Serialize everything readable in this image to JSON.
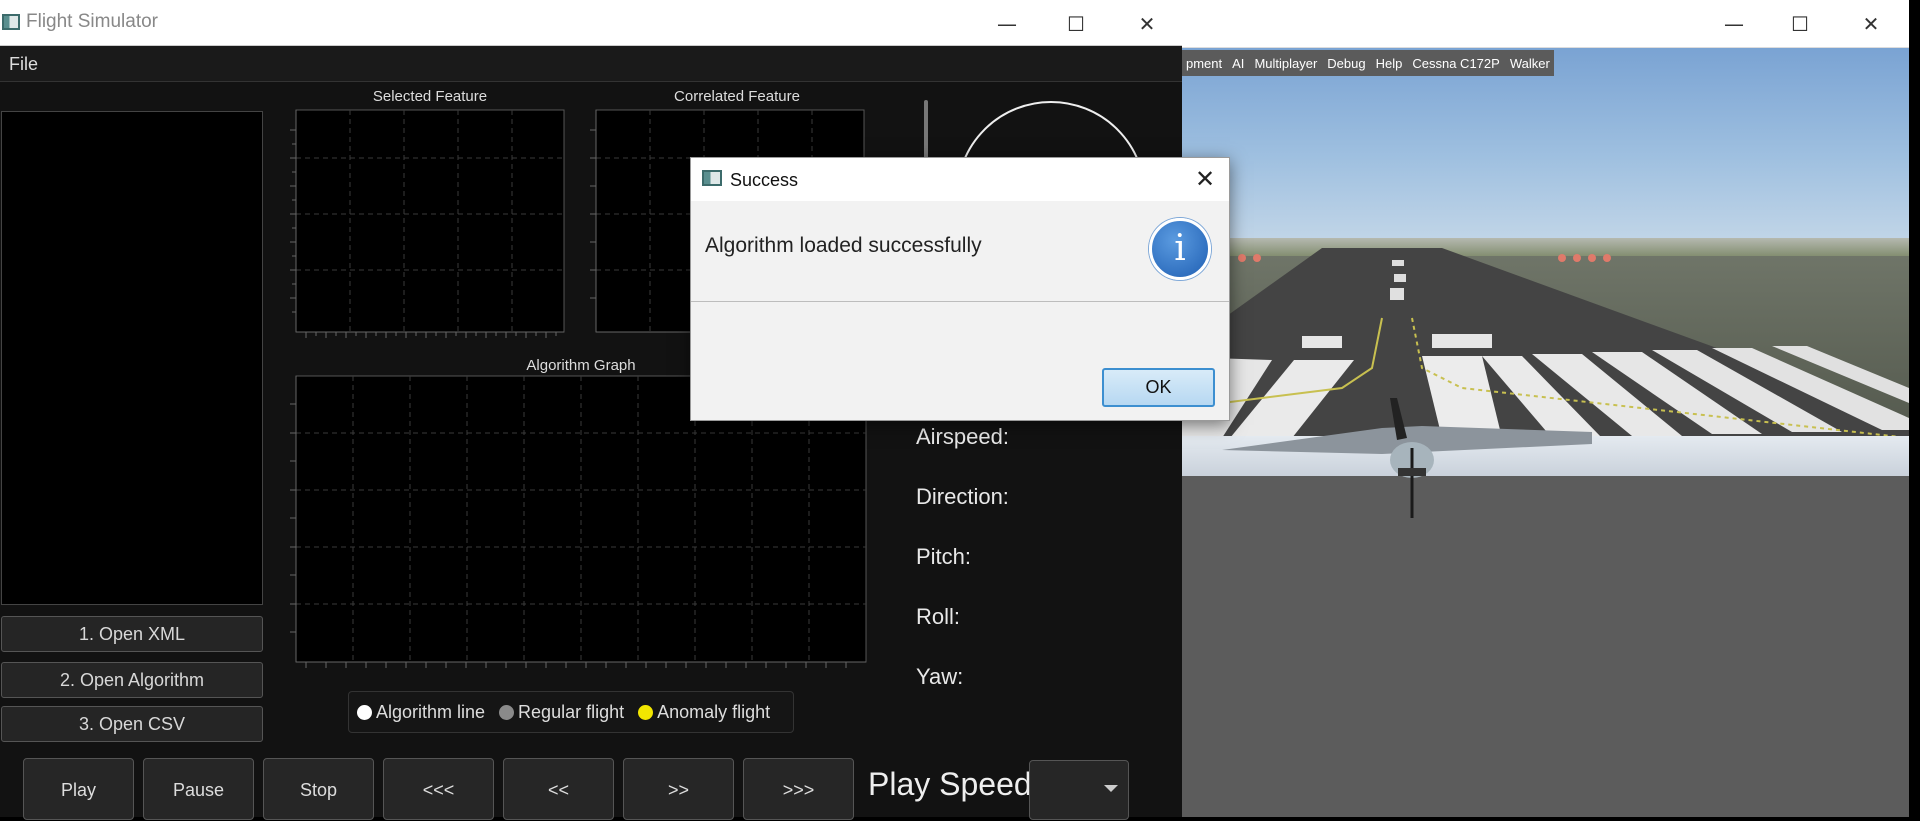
{
  "flightgear": {
    "menu": [
      "pment",
      "AI",
      "Multiplayer",
      "Debug",
      "Help",
      "Cessna C172P",
      "Walker"
    ],
    "controls": {
      "minimize": "—",
      "maximize": "☐",
      "close": "✕"
    }
  },
  "app": {
    "title": "Flight Simulator",
    "menu": {
      "file": "File"
    },
    "controls": {
      "minimize": "—",
      "maximize": "☐",
      "close": "✕"
    },
    "charts": {
      "selected_feature": "Selected Feature",
      "correlated_feature": "Correlated Feature",
      "algorithm_graph": "Algorithm Graph"
    },
    "buttons": {
      "open_xml": "1. Open XML",
      "open_algorithm": "2. Open Algorithm",
      "open_csv": "3. Open CSV"
    },
    "legend": [
      {
        "label": "Algorithm line",
        "color": "#ffffff"
      },
      {
        "label": "Regular flight",
        "color": "#8a8a8a"
      },
      {
        "label": "Anomaly flight",
        "color": "#f2e600"
      }
    ],
    "flight_data": {
      "airspeed": "Airspeed:",
      "direction": "Direction:",
      "pitch": "Pitch:",
      "roll": "Roll:",
      "yaw": "Yaw:"
    },
    "player": {
      "play": "Play",
      "pause": "Pause",
      "stop": "Stop",
      "rewind_fast": "<<<",
      "rewind": "<<",
      "forward": ">>",
      "forward_fast": ">>>",
      "play_speed_label": "Play Speed",
      "play_speed_value": ""
    }
  },
  "dialog": {
    "title": "Success",
    "message": "Algorithm loaded successfully",
    "info_icon_glyph": "i",
    "close": "✕",
    "ok_label": "OK"
  }
}
